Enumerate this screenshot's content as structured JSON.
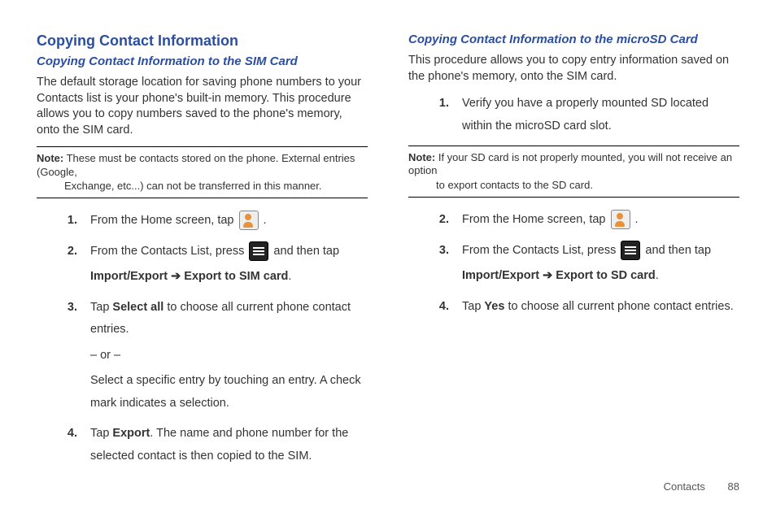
{
  "left": {
    "heading": "Copying Contact Information",
    "subheading": "Copying Contact Information to the SIM Card",
    "intro": "The default storage location for saving phone numbers to your Contacts list is your phone's built-in memory. This procedure allows you to copy numbers saved to the phone's memory, onto the SIM card.",
    "note_label": "Note:",
    "note_first": " These must be contacts stored on the phone. External entries (Google,",
    "note_rest": "Exchange, etc...) can not be transferred in this manner.",
    "steps": {
      "n1": "1.",
      "s1_a": "From the Home screen, tap ",
      "s1_b": " .",
      "n2": "2.",
      "s2_a": "From the Contacts List, press ",
      "s2_b": " and then tap ",
      "s2_c1": "Import/Export",
      "s2_arrow": " ➔ ",
      "s2_c2": "Export to SIM card",
      "s2_d": ".",
      "n3": "3.",
      "s3_a": "Tap ",
      "s3_b": "Select all",
      "s3_c": " to choose all current phone contact entries.",
      "s3_or": "– or –",
      "s3_alt": "Select a specific entry by touching an entry. A check mark indicates a selection.",
      "n4": "4.",
      "s4_a": "Tap ",
      "s4_b": "Export",
      "s4_c": ". The name and phone number for the selected contact is then copied to the SIM."
    }
  },
  "right": {
    "subheading": "Copying Contact Information to the microSD Card",
    "intro": "This procedure allows you to copy entry information saved on the phone's memory, onto the SIM card.",
    "note_label": "Note:",
    "note_first": " If your SD card is not properly mounted, you will not receive an option",
    "note_rest": "to export contacts to the SD card.",
    "steps": {
      "n1": "1.",
      "s1": "Verify you have a properly mounted SD located within the microSD card slot.",
      "n2": "2.",
      "s2_a": "From the Home screen, tap ",
      "s2_b": " .",
      "n3": "3.",
      "s3_a": "From the Contacts List, press ",
      "s3_b": " and then tap ",
      "s3_c1": "Import/Export",
      "s3_arrow": " ➔ ",
      "s3_c2": "Export to SD card",
      "s3_d": ".",
      "n4": "4.",
      "s4_a": "Tap ",
      "s4_b": "Yes",
      "s4_c": " to choose all current phone contact entries."
    }
  },
  "footer": {
    "section": "Contacts",
    "page": "88"
  }
}
